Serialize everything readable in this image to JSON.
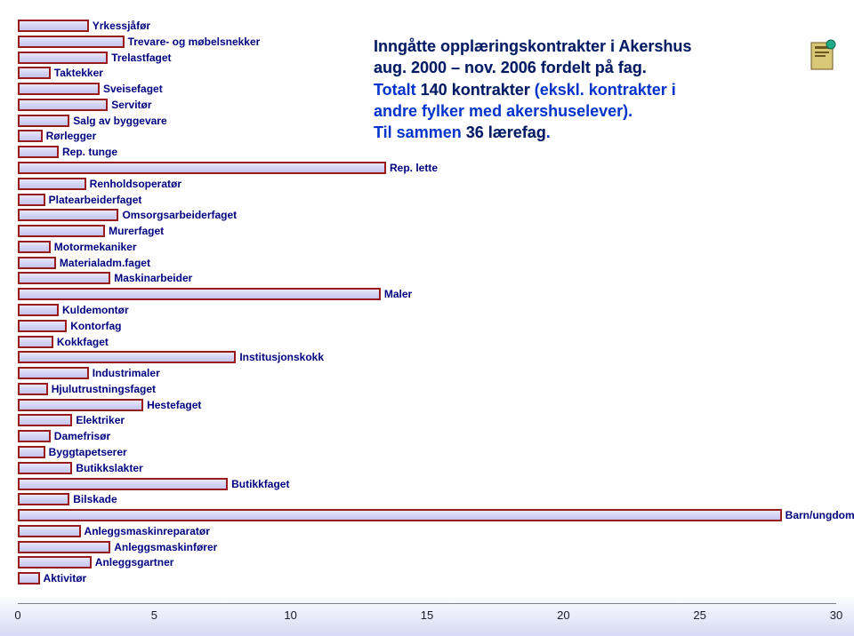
{
  "chart_data": {
    "type": "bar",
    "orientation": "horizontal",
    "title_lines": [
      {
        "text": "Inngåtte opplæringskontrakter i Akershus",
        "cls": "dark"
      },
      {
        "text": "aug. 2000 – nov. 2006 fordelt på fag.",
        "cls": "dark"
      },
      {
        "text_parts": [
          {
            "t": "Totalt ",
            "cls": "blue"
          },
          {
            "t": "140 kontrakter",
            "cls": "dark"
          },
          {
            "t": " (ekskl. kontrakter i",
            "cls": "blue"
          }
        ]
      },
      {
        "text": "andre fylker med akershuselever).",
        "cls": "blue"
      },
      {
        "text_parts": [
          {
            "t": "Til sammen ",
            "cls": "blue"
          },
          {
            "t": "36 lærefag",
            "cls": "dark"
          },
          {
            "t": ".",
            "cls": "blue"
          }
        ]
      }
    ],
    "x_ticks": [
      0,
      5,
      10,
      15,
      20,
      25,
      30
    ],
    "x_max": 30,
    "bars": [
      {
        "label": "Yrkessjåfør",
        "value": 2.6
      },
      {
        "label": "Trevare- og møbelsnekker",
        "value": 3.9
      },
      {
        "label": "Trelastfaget",
        "value": 3.3
      },
      {
        "label": "Taktekker",
        "value": 1.2
      },
      {
        "label": "Sveisefaget",
        "value": 3.0
      },
      {
        "label": "Servitør",
        "value": 3.3
      },
      {
        "label": "Salg av byggevare",
        "value": 1.9
      },
      {
        "label": "Rørlegger",
        "value": 0.9
      },
      {
        "label": "Rep. tunge",
        "value": 1.5
      },
      {
        "label": "Rep. lette",
        "value": 13.5
      },
      {
        "label": "Renholdsoperatør",
        "value": 2.5
      },
      {
        "label": "Platearbeiderfaget",
        "value": 1.0
      },
      {
        "label": "Omsorgsarbeiderfaget",
        "value": 3.7
      },
      {
        "label": "Murerfaget",
        "value": 3.2
      },
      {
        "label": "Motormekaniker",
        "value": 1.2
      },
      {
        "label": "Materialadm.faget",
        "value": 1.4
      },
      {
        "label": "Maskinarbeider",
        "value": 3.4
      },
      {
        "label": "Maler",
        "value": 13.3
      },
      {
        "label": "Kuldemontør",
        "value": 1.5
      },
      {
        "label": "Kontorfag",
        "value": 1.8
      },
      {
        "label": "Kokkfaget",
        "value": 1.3
      },
      {
        "label": "Institusjonskokk",
        "value": 8.0
      },
      {
        "label": "Industrimaler",
        "value": 2.6
      },
      {
        "label": "Hjulutrustningsfaget",
        "value": 1.1
      },
      {
        "label": "Hestefaget",
        "value": 4.6
      },
      {
        "label": "Elektriker",
        "value": 2.0
      },
      {
        "label": "Damefrisør",
        "value": 1.2
      },
      {
        "label": "Byggtapetserer",
        "value": 1.0
      },
      {
        "label": "Butikkslakter",
        "value": 2.0
      },
      {
        "label": "Butikkfaget",
        "value": 7.7
      },
      {
        "label": "Bilskade",
        "value": 1.9
      },
      {
        "label": "Barn/ungdom",
        "value": 28.0
      },
      {
        "label": "Anleggsmaskinreparatør",
        "value": 2.3
      },
      {
        "label": "Anleggsmaskinfører",
        "value": 3.4
      },
      {
        "label": "Anleggsgartner",
        "value": 2.7
      },
      {
        "label": "Aktivitør",
        "value": 0.8
      }
    ]
  }
}
